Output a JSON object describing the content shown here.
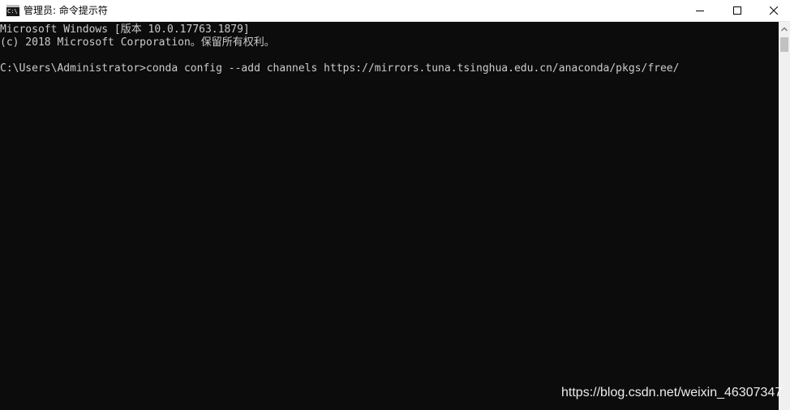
{
  "window": {
    "title": "管理员: 命令提示符",
    "icon": "cmd-icon",
    "icon_text": "C:\\",
    "controls": {
      "minimize": "minimize-icon",
      "maximize": "maximize-icon",
      "close": "close-icon"
    }
  },
  "console": {
    "lines": [
      "Microsoft Windows [版本 10.0.17763.1879]",
      "(c) 2018 Microsoft Corporation。保留所有权利。",
      "C:\\Users\\Administrator>conda config --add channels https://mirrors.tuna.tsinghua.edu.cn/anaconda/pkgs/free/"
    ],
    "background": "#0c0c0c",
    "foreground": "#cccccc"
  },
  "watermark": {
    "text": "https://blog.csdn.net/weixin_46307347"
  }
}
